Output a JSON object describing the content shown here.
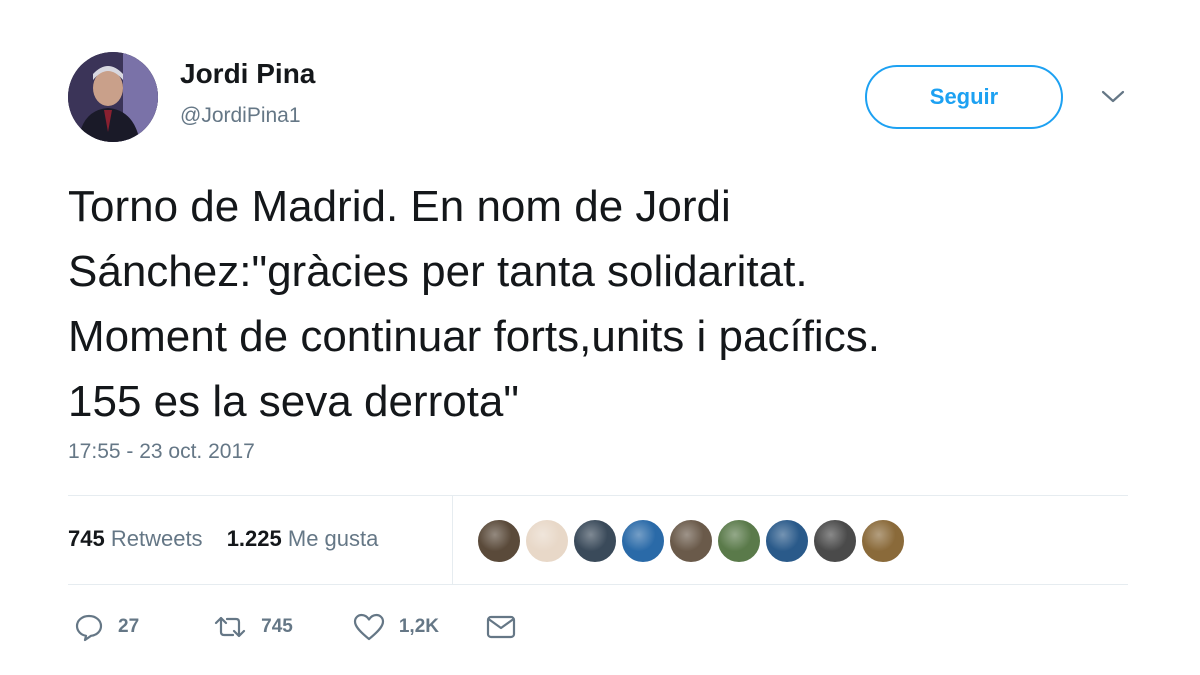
{
  "user": {
    "display_name": "Jordi Pina",
    "handle": "@JordiPina1",
    "avatar_icon": "profile-photo"
  },
  "follow_button": {
    "label": "Seguir",
    "color": "#1da1f2"
  },
  "tweet": {
    "lines": [
      "Torno de Madrid. En nom de Jordi",
      "Sánchez:\"gràcies per tanta solidaritat.",
      "Moment de continuar forts,units i pacífics.",
      "155 es la seva derrota\""
    ],
    "timestamp": "17:55 - 23 oct. 2017"
  },
  "stats": {
    "retweets_count": "745",
    "retweets_label": "Retweets",
    "likes_count": "1.225",
    "likes_label": "Me gusta"
  },
  "likers": [
    {
      "color": "#5a4a3a"
    },
    {
      "color": "#e8d8c8"
    },
    {
      "color": "#3a4a5a"
    },
    {
      "color": "#2a6aa8"
    },
    {
      "color": "#6a5a4a"
    },
    {
      "color": "#5a7a4a"
    },
    {
      "color": "#2a5a8a"
    },
    {
      "color": "#4a4a4a"
    },
    {
      "color": "#8a6a3a"
    }
  ],
  "actions": {
    "reply_count": "27",
    "retweet_count": "745",
    "like_count": "1,2K"
  },
  "colors": {
    "text": "#14171a",
    "secondary": "#657786",
    "accent": "#1da1f2",
    "border": "#e6ecf0"
  }
}
